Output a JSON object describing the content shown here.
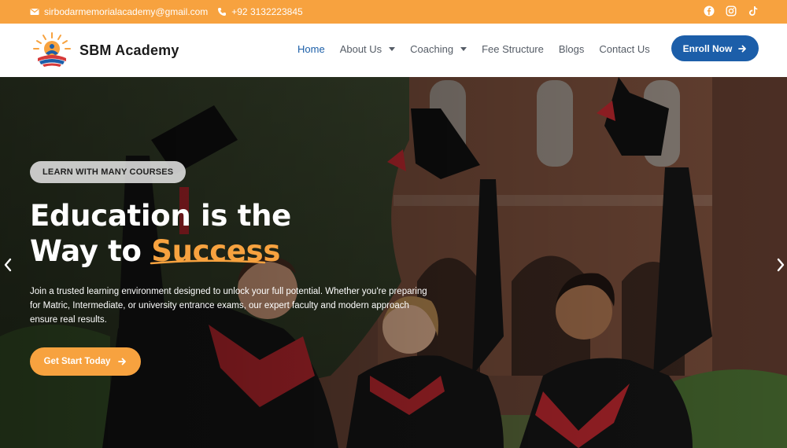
{
  "topbar": {
    "email": "sirbodarmemorialacademy@gmail.com",
    "phone": "+92 3132223845",
    "email_icon": "envelope-icon",
    "phone_icon": "phone-icon",
    "social": [
      "facebook-icon",
      "instagram-icon",
      "tiktok-icon"
    ],
    "bg_color": "#f7a23f"
  },
  "header": {
    "brand": "SBM Academy",
    "nav": [
      {
        "label": "Home",
        "active": true
      },
      {
        "label": "About Us",
        "dropdown": true
      },
      {
        "label": "Coaching",
        "dropdown": true
      },
      {
        "label": "Fee Structure"
      },
      {
        "label": "Blogs"
      },
      {
        "label": "Contact Us"
      }
    ],
    "cta": "Enroll Now",
    "cta_color": "#1c5ea9"
  },
  "hero": {
    "badge": "LEARN WITH MANY COURSES",
    "headline_line1": "Education is the",
    "headline_line2_prefix": "Way to",
    "headline_accent": "Success",
    "accent_color": "#f7a23f",
    "description": "Join a trusted learning environment designed to unlock your full potential. Whether you're preparing for Matric, Intermediate, or university entrance exams, our expert faculty and modern approach ensure real results.",
    "cta": "Get Start Today"
  }
}
